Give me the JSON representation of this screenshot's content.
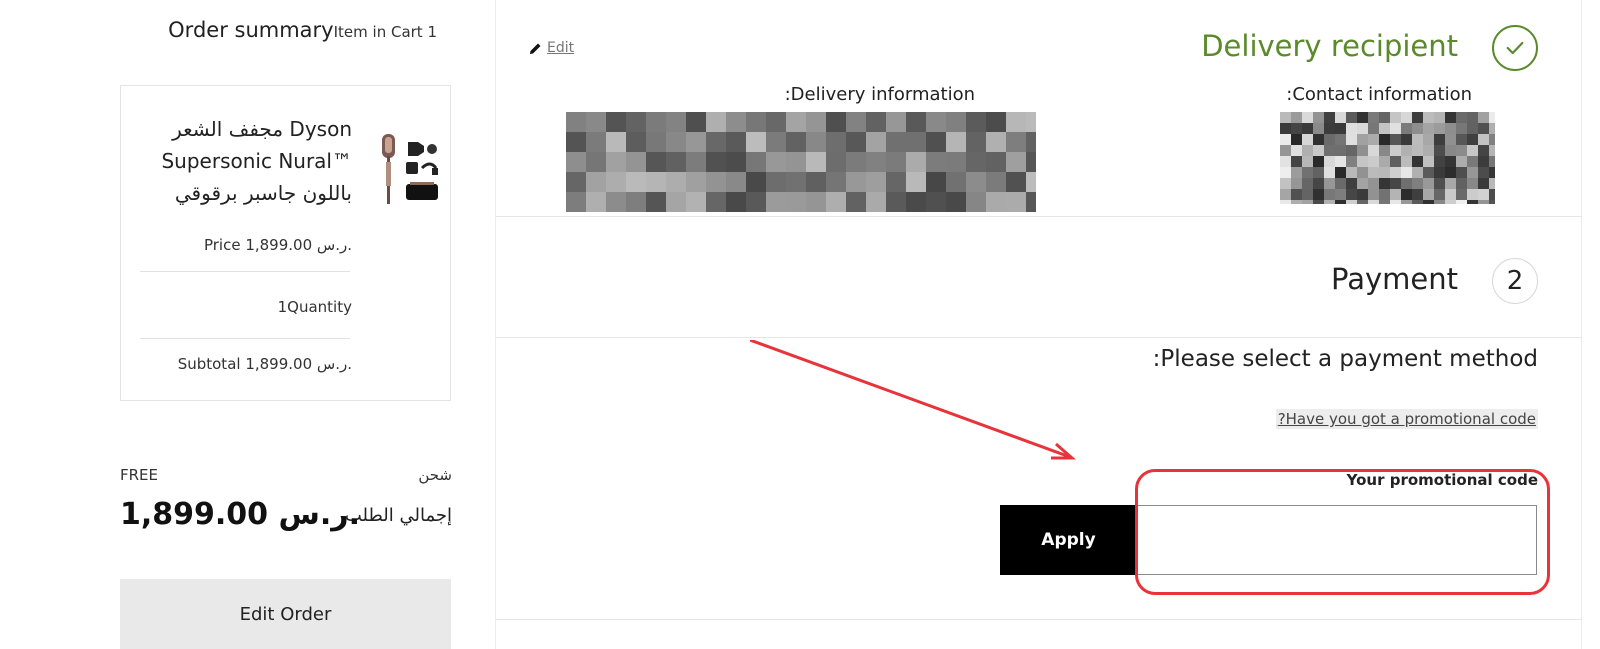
{
  "order_summary": {
    "title": "Order summary",
    "cart_count_text": "Item in Cart 1"
  },
  "cart_item": {
    "name_line1": "مجفف الشعر Dyson",
    "name_line2": "Supersonic Nural™",
    "name_line3": "باللون جاسبر برقوقي",
    "price_text": "Price 1,899.00 ر.س.",
    "quantity_text": "1Quantity",
    "subtotal_text": "Subtotal 1,899.00 ر.س."
  },
  "totals": {
    "shipping_label": "شحن",
    "shipping_value": "FREE",
    "total_label": "إجمالي الطلب",
    "total_value": "1,899.00 ر.س."
  },
  "edit_order_label": "Edit Order",
  "delivery_recipient": {
    "title": "Delivery recipient",
    "edit_link": "Edit",
    "delivery_info_label": ":Delivery information",
    "contact_info_label": ":Contact information",
    "status_icon": "check-icon"
  },
  "payment": {
    "title": "Payment",
    "step_number": "2",
    "select_method_text": ":Please select a payment method",
    "promo_link_text": "?Have you got a promotional code",
    "promo_label": "Your promotional code",
    "promo_input_value": "",
    "apply_label": "Apply"
  },
  "colors": {
    "accent_green": "#5a8a2c",
    "annotation_red": "#e8333a",
    "button_black": "#000000"
  }
}
